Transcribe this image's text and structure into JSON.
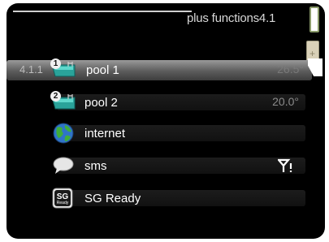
{
  "header": {
    "title": "plus functions",
    "menu_number": "4.1"
  },
  "menu": {
    "selected_code": "4.1.1",
    "items": [
      {
        "label": "pool 1",
        "value": "26.5°",
        "badge": "1",
        "icon": "pool-icon"
      },
      {
        "label": "pool 2",
        "value": "20.0°",
        "badge": "2",
        "icon": "pool-icon"
      },
      {
        "label": "internet",
        "value": "",
        "icon": "globe-icon"
      },
      {
        "label": "sms",
        "value": "",
        "icon": "speech-bubble-icon",
        "status_icon": "antenna-signal-icon"
      },
      {
        "label": "SG Ready",
        "value": "",
        "icon": "sg-ready-icon",
        "icon_text": "SG",
        "icon_subtext": "Ready"
      }
    ]
  }
}
